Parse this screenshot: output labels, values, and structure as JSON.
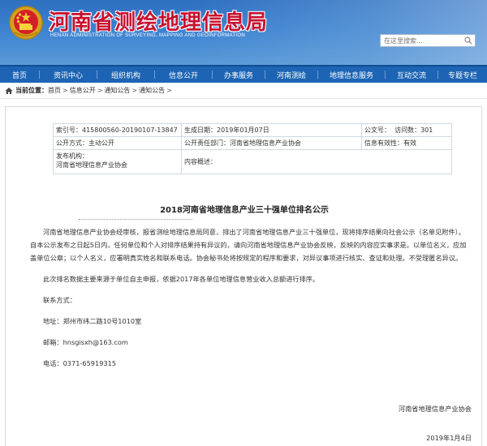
{
  "header": {
    "title": "河南省测绘地理信息局",
    "subtitle": "HENAN ADMINISTRATION OF SURVEYING, MAPPING AND GEOINFORMATION",
    "search_placeholder": "在这里搜索...",
    "colors": {
      "title": "#c8102e",
      "banner": "#2f6fc0"
    }
  },
  "nav": {
    "items": [
      "首页",
      "资讯中心",
      "组织机构",
      "信息公开",
      "办事服务",
      "河南测绘",
      "地理信息服务",
      "互动交流",
      "专题专栏"
    ]
  },
  "breadcrumb": {
    "label": "当前位置：",
    "items": [
      "首页",
      "信息公开",
      "通知公告",
      "通知公告"
    ],
    "separator": ">"
  },
  "meta": {
    "index_label": "索引号：",
    "index_value": "415800560-20190107-13847",
    "gen_date_label": "生成日期：",
    "gen_date_value": "2019年01月07日",
    "doc_no_label": "公文号：",
    "visits_label": "访问数：",
    "visits_value": "301",
    "open_method_label": "公开方式：",
    "open_method_value": "主动公开",
    "dept_label": "公开责任部门：",
    "dept_value": "河南省地理信息产业协会",
    "validity_label": "信息有效性：",
    "validity_value": "有效",
    "issuer_label": "发布机构：",
    "issuer_value": "河南省地理信息产业协会",
    "summary_label": "内容概述："
  },
  "article": {
    "title": "2018河南省地理信息产业三十强单位排名公示",
    "para1": "河南省地理信息产业协会经审核，报省测绘地理信息局同意，排出了河南省地理信息产业三十强单位，现将排序结果向社会公示（名单见附件）。自本公示发布之日起5日内，任何单位和个人对排序结果持有异议的，请向河南省地理信息产业协会反映，反映的内容应实事求是。以单位名义，应加盖单位公章；以个人名义，应署明真实姓名和联系电话。协会秘书处将按规定的程序和要求，对异议事项进行核实、查证和处理。不受理匿名异议。",
    "para2": "此次排名数据主要来源于单位自主申报，依据2017年各单位地理信息营业收入总额进行排序。",
    "contact_title": "联系方式：",
    "address": "地址：郑州市纬二路10号1010室",
    "email": "邮箱：hnsgisxh@163.com",
    "phone": "电话：0371-65919315",
    "signature": "河南省地理信息产业协会",
    "date": "2019年1月4日"
  }
}
